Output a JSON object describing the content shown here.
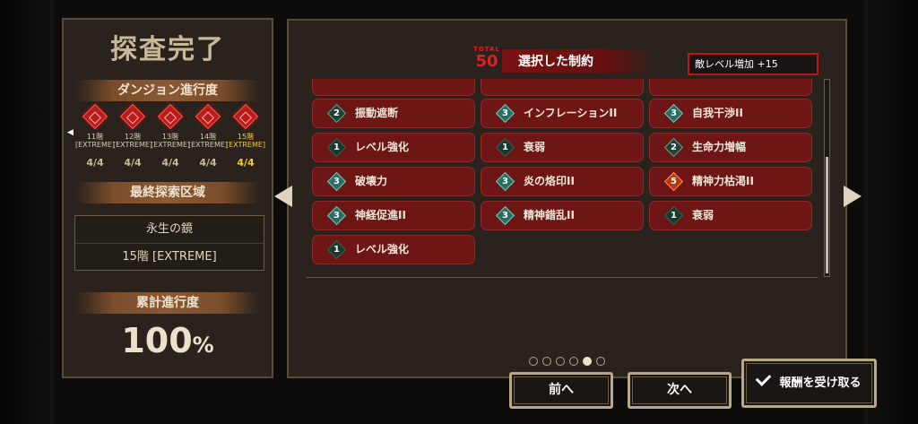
{
  "left": {
    "title": "探査完了",
    "progress_banner": "ダンジョン進行度",
    "floors": [
      {
        "floor": "11階",
        "difficulty": "[EXTREME]",
        "count": "4/4",
        "current": false
      },
      {
        "floor": "12階",
        "difficulty": "[EXTREME]",
        "count": "4/4",
        "current": false
      },
      {
        "floor": "13階",
        "difficulty": "[EXTREME]",
        "count": "4/4",
        "current": false
      },
      {
        "floor": "14階",
        "difficulty": "[EXTREME]",
        "count": "4/4",
        "current": false
      },
      {
        "floor": "15階",
        "difficulty": "[EXTREME]",
        "count": "4/4",
        "current": true
      }
    ],
    "area_banner": "最終探索区域",
    "area_name": "永生の鏡",
    "area_floor": "15階 [EXTREME]",
    "cumulative_banner": "累計進行度",
    "cumulative_value": "100",
    "cumulative_unit": "%"
  },
  "header": {
    "total_label": "TOTAL",
    "total_value": "50",
    "title": "選択した制約",
    "tooltip": "敵レベル増加 +15"
  },
  "constraints": [
    {
      "level": "2",
      "label": "振動遮断"
    },
    {
      "level": "3",
      "label": "インフレーションII"
    },
    {
      "level": "3",
      "label": "自我干渉II"
    },
    {
      "level": "1",
      "label": "レベル強化"
    },
    {
      "level": "1",
      "label": "衰弱"
    },
    {
      "level": "2",
      "label": "生命力増幅"
    },
    {
      "level": "3",
      "label": "破壊力"
    },
    {
      "level": "3",
      "label": "炎の烙印II"
    },
    {
      "level": "5",
      "label": "精神力枯渇II"
    },
    {
      "level": "3",
      "label": "神経促進II"
    },
    {
      "level": "3",
      "label": "精神錯乱II"
    },
    {
      "level": "1",
      "label": "衰弱"
    },
    {
      "level": "1",
      "label": "レベル強化"
    }
  ],
  "scroll_position": 0.55,
  "pagination": {
    "total": 6,
    "active": 5
  },
  "buttons": {
    "prev": "前へ",
    "next": "次へ",
    "receive": "報酬を受け取る"
  },
  "colors": {
    "cell": "#6e1616",
    "accent": "#e01f1f",
    "current_floor": "#f2c832"
  }
}
